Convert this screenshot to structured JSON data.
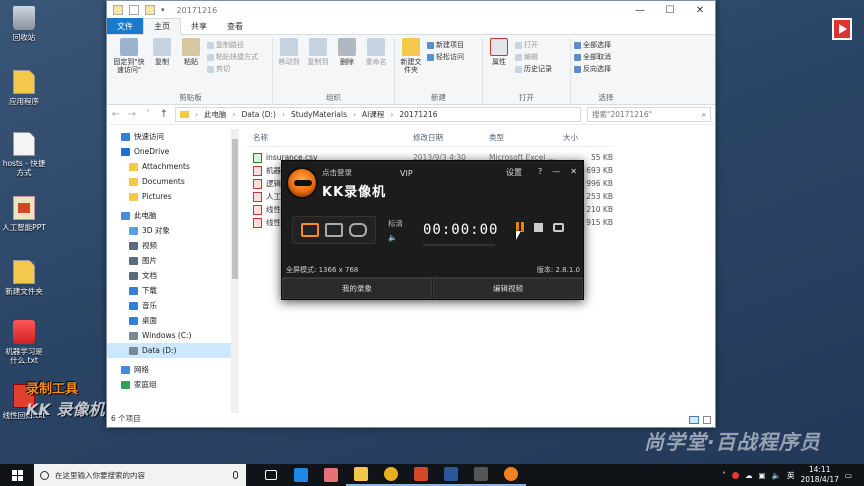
{
  "desktop": {
    "icons": [
      {
        "label": "回收站",
        "icon": "recycle-bin-icon"
      },
      {
        "label": "应用程序",
        "icon": "folder-shortcut-icon"
      },
      {
        "label": "hosts - 快捷方式",
        "icon": "file-shortcut-icon"
      },
      {
        "label": "人工智能PPT",
        "icon": "ppt-icon"
      },
      {
        "label": "新建文件夹",
        "icon": "folder-icon"
      },
      {
        "label": "机器学习是什么.txt",
        "icon": "text-file-icon"
      },
      {
        "label": "线性回归.txt",
        "icon": "text-file-icon"
      }
    ]
  },
  "explorer": {
    "title": "20171216",
    "window_controls": [
      "—",
      "☐",
      "✕"
    ],
    "tabs": [
      "文件",
      "主页",
      "共享",
      "查看"
    ],
    "ribbon": {
      "clipboard": {
        "label": "剪贴板",
        "pin": "固定到\"快速访问\"",
        "copy": "复制",
        "paste": "粘贴",
        "copy_path": "复制路径",
        "paste_shortcut": "粘贴快捷方式",
        "cut": "剪切"
      },
      "organize": {
        "label": "组织",
        "move_to": "移动到",
        "copy_to": "复制到",
        "delete": "删除",
        "rename": "重命名"
      },
      "new": {
        "label": "新建",
        "new_item": "新建项目",
        "easy_access": "轻松访问",
        "new_folder": "新建文件夹"
      },
      "open": {
        "label": "打开",
        "properties": "属性",
        "open": "打开",
        "edit": "编辑",
        "history": "历史记录"
      },
      "select": {
        "label": "选择",
        "select_all": "全部选择",
        "select_none": "全部取消",
        "invert": "反向选择"
      }
    },
    "address": [
      "此电脑",
      "Data (D:)",
      "StudyMaterials",
      "AI课程",
      "20171216"
    ],
    "search_placeholder": "搜索\"20171216\"",
    "nav": [
      {
        "label": "快速访问",
        "color": "#3a7bd5",
        "indent": 0
      },
      {
        "label": "OneDrive",
        "color": "#1d6fce",
        "indent": 0
      },
      {
        "label": "Attachments",
        "color": "#f3c84b",
        "indent": 1
      },
      {
        "label": "Documents",
        "color": "#f3c84b",
        "indent": 1
      },
      {
        "label": "Pictures",
        "color": "#f3c84b",
        "indent": 1
      },
      {
        "label": "此电脑",
        "color": "#4a8ad6",
        "indent": 0
      },
      {
        "label": "3D 对象",
        "color": "#5aa0e0",
        "indent": 1
      },
      {
        "label": "视频",
        "color": "#5a6b7d",
        "indent": 1
      },
      {
        "label": "图片",
        "color": "#5a6b7d",
        "indent": 1
      },
      {
        "label": "文档",
        "color": "#5a6b7d",
        "indent": 1
      },
      {
        "label": "下载",
        "color": "#3a7bd5",
        "indent": 1
      },
      {
        "label": "音乐",
        "color": "#3a7bd5",
        "indent": 1
      },
      {
        "label": "桌面",
        "color": "#3a7bd5",
        "indent": 1
      },
      {
        "label": "Windows (C:)",
        "color": "#7a8895",
        "indent": 1
      },
      {
        "label": "Data (D:)",
        "color": "#7a8895",
        "indent": 1,
        "selected": true
      },
      {
        "label": "网络",
        "color": "#4a8ad6",
        "indent": 0
      },
      {
        "label": "家庭组",
        "color": "#3a9a5a",
        "indent": 0
      }
    ],
    "columns": [
      "名称",
      "修改日期",
      "类型",
      "大小"
    ],
    "files": [
      {
        "name": "insurance.csv",
        "date": "2013/9/3 4:30",
        "type": "Microsoft Excel ...",
        "size": "55 KB",
        "kind": "csv"
      },
      {
        "name": "机器",
        "date": "",
        "type": "",
        "size": "693 KB",
        "kind": "pdf"
      },
      {
        "name": "逻辑",
        "date": "",
        "type": "",
        "size": "996 KB",
        "kind": "pdf"
      },
      {
        "name": "人工",
        "date": "",
        "type": "",
        "size": "253 KB",
        "kind": "pdf"
      },
      {
        "name": "线性",
        "date": "",
        "type": "",
        "size": "210 KB",
        "kind": "pdf"
      },
      {
        "name": "线性",
        "date": "",
        "type": "",
        "size": "915 KB",
        "kind": "pdf"
      }
    ],
    "status": "6 个项目"
  },
  "kk": {
    "login": "点击登录",
    "brand": "KK录像机",
    "vip": "VIP",
    "settings": "设置",
    "help": "?",
    "minimize": "—",
    "close": "✕",
    "quality": "标清",
    "timer": "00:00:00",
    "mode_info": "全屏模式: 1366 x 768",
    "version": "版本: 2.8.1.0",
    "my_recordings": "我的录象",
    "edit_video": "编辑视频"
  },
  "watermarks": {
    "tool_line1": "录制工具",
    "tool_line2": "KK 录像机",
    "brand": "尚学堂·百战程序员"
  },
  "taskbar": {
    "search_placeholder": "在这里输入你要搜索的内容",
    "apps": [
      {
        "name": "task-view",
        "color": "#ffffff"
      },
      {
        "name": "edge",
        "color": "#1e88e5"
      },
      {
        "name": "app-3",
        "color": "#e57373"
      },
      {
        "name": "explorer",
        "color": "#f3c84b"
      },
      {
        "name": "chrome",
        "color": "#e8b020"
      },
      {
        "name": "powerpoint",
        "color": "#d24726"
      },
      {
        "name": "word",
        "color": "#2b579a"
      },
      {
        "name": "media",
        "color": "#555555"
      },
      {
        "name": "kk-recorder",
        "color": "#f08020"
      }
    ],
    "ime": "英",
    "time": "14:11",
    "date": "2018/4/17"
  }
}
